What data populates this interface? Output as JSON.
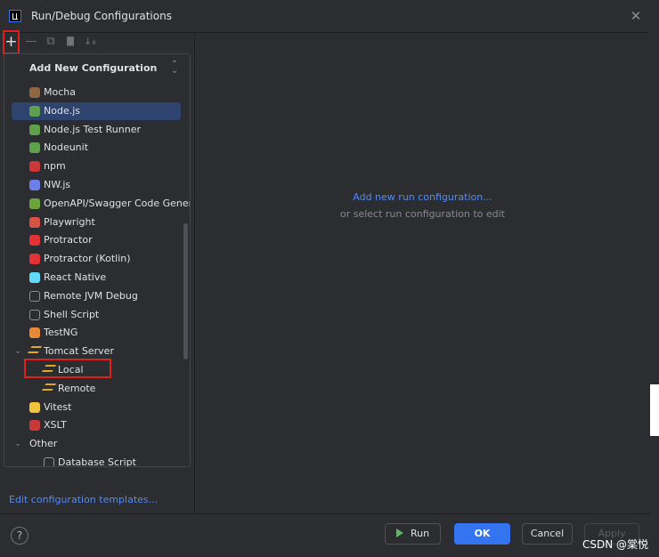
{
  "window": {
    "title": "Run/Debug Configurations"
  },
  "toolbar": {
    "add": "+",
    "remove": "—",
    "copy": "⧉",
    "folder": "▇",
    "sort": "↓₈"
  },
  "popup": {
    "title": "Add New Configuration",
    "items": [
      {
        "label": "Mocha",
        "icon": "mocha-icon",
        "color": "#8d6748"
      },
      {
        "label": "Node.js",
        "icon": "nodejs-icon",
        "color": "#5fa04e"
      },
      {
        "label": "Node.js Test Runner",
        "icon": "nodejs-test-icon",
        "color": "#5fa04e"
      },
      {
        "label": "Nodeunit",
        "icon": "nodeunit-icon",
        "color": "#5fa04e"
      },
      {
        "label": "npm",
        "icon": "npm-icon",
        "color": "#cb3837"
      },
      {
        "label": "NW.js",
        "icon": "nwjs-icon",
        "color": "#6c7ee8"
      },
      {
        "label": "OpenAPI/Swagger Code Generat",
        "icon": "openapi-icon",
        "color": "#6ba539"
      },
      {
        "label": "Playwright",
        "icon": "playwright-icon",
        "color": "#d65348"
      },
      {
        "label": "Protractor",
        "icon": "protractor-icon",
        "color": "#e23237"
      },
      {
        "label": "Protractor (Kotlin)",
        "icon": "protractor-kotlin-icon",
        "color": "#e23237"
      },
      {
        "label": "React Native",
        "icon": "react-icon",
        "color": "#61dafb"
      },
      {
        "label": "Remote JVM Debug",
        "icon": "remote-debug-icon",
        "color": "#8c8f94"
      },
      {
        "label": "Shell Script",
        "icon": "shell-icon",
        "color": "#8c8f94"
      },
      {
        "label": "TestNG",
        "icon": "testng-icon",
        "color": "#e8893a"
      },
      {
        "label": "Tomcat Server",
        "icon": "tomcat-icon",
        "color": "#e0a826"
      },
      {
        "label": "Local",
        "icon": "tomcat-local-icon",
        "color": "#e0a826"
      },
      {
        "label": "Remote",
        "icon": "tomcat-remote-icon",
        "color": "#e0a826"
      },
      {
        "label": "Vitest",
        "icon": "vitest-icon",
        "color": "#f0c43a"
      },
      {
        "label": "XSLT",
        "icon": "xslt-icon",
        "color": "#c83a3a"
      },
      {
        "label": "Other",
        "icon": "",
        "color": ""
      },
      {
        "label": "Database Script",
        "icon": "database-icon",
        "color": "#8c8f94"
      }
    ]
  },
  "left_footer": {
    "edit_templates": "Edit configuration templates..."
  },
  "main": {
    "add_link": "Add new run configuration...",
    "hint": "or select run configuration to edit"
  },
  "footer": {
    "help": "?",
    "run": "Run",
    "ok": "OK",
    "cancel": "Cancel",
    "apply": "Apply"
  },
  "watermark": "CSDN @棠悦",
  "colors": {
    "background": "#2b2d30",
    "accent": "#3574f0",
    "link": "#548af7",
    "selection": "#2e436e",
    "annotation_red": "#e0211a"
  }
}
